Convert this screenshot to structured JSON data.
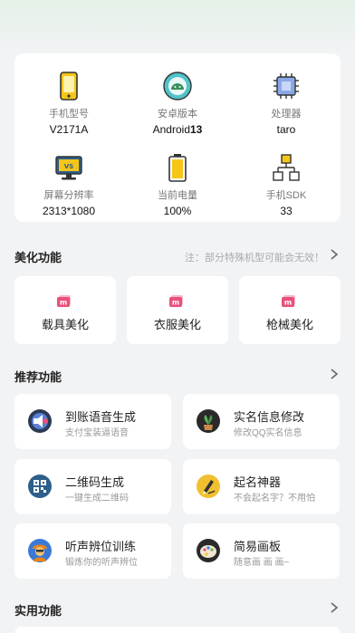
{
  "device_info": {
    "items": [
      {
        "label": "手机型号",
        "value": "V2171A",
        "icon": "phone-icon"
      },
      {
        "label": "安卓版本",
        "value_prefix": "Android",
        "value_bold": "13",
        "icon": "android-icon"
      },
      {
        "label": "处理器",
        "value": "taro",
        "icon": "chip-icon"
      },
      {
        "label": "屏幕分辨率",
        "value": "2313*1080",
        "icon": "monitor-icon"
      },
      {
        "label": "当前电量",
        "value": "100%",
        "icon": "battery-icon"
      },
      {
        "label": "手机SDK",
        "value": "33",
        "icon": "network-icon"
      }
    ]
  },
  "beauty": {
    "title": "美化功能",
    "note": "注：部分特殊机型可能会无效！",
    "items": [
      {
        "label": "载具美化",
        "icon": "m-logo-icon"
      },
      {
        "label": "衣服美化",
        "icon": "m-logo-icon"
      },
      {
        "label": "枪械美化",
        "icon": "m-logo-icon"
      }
    ]
  },
  "recommended": {
    "title": "推荐功能",
    "items": [
      {
        "title": "到账语音生成",
        "subtitle": "支付宝装逼语音",
        "icon": "speaker-icon"
      },
      {
        "title": "实名信息修改",
        "subtitle": "修改QQ实名信息",
        "icon": "plant-icon"
      },
      {
        "title": "二维码生成",
        "subtitle": "一键生成二维码",
        "icon": "qr-code-icon"
      },
      {
        "title": "起名神器",
        "subtitle": "不会起名字？不用怕",
        "icon": "pen-icon"
      },
      {
        "title": "听声辨位训练",
        "subtitle": "锻炼你的听声辨位",
        "icon": "soldier-icon"
      },
      {
        "title": "简易画板",
        "subtitle": "随意画 画 画~",
        "icon": "palette-icon"
      }
    ]
  },
  "utility": {
    "title": "实用功能"
  },
  "colors": {
    "accent_green": "#e4f1e7",
    "brand_pink": "#e8517a"
  }
}
